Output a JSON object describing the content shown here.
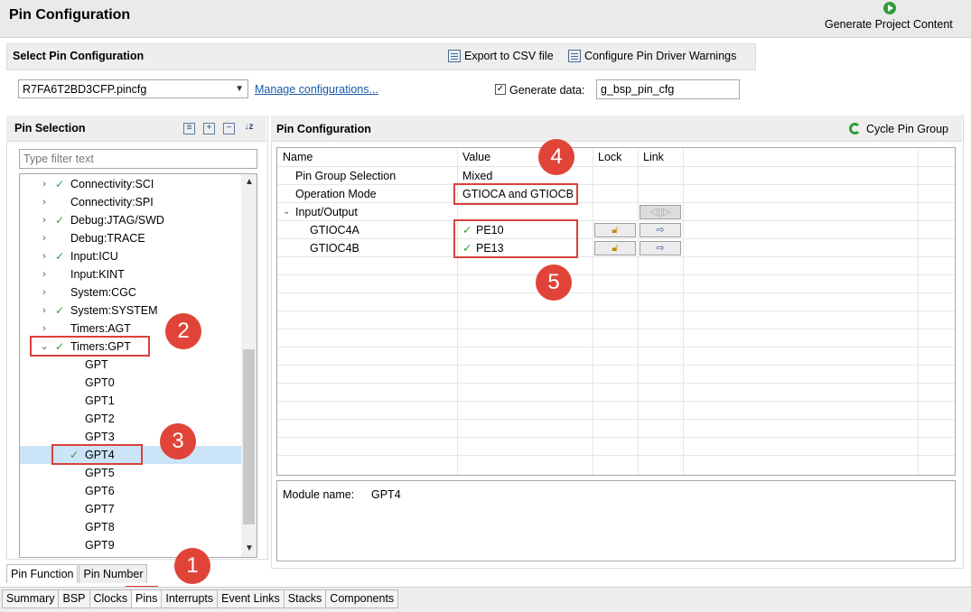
{
  "header": {
    "title": "Pin Configuration",
    "generate_label": "Generate Project Content"
  },
  "select_section": {
    "title": "Select Pin Configuration",
    "export_label": "Export to CSV file",
    "warnings_label": "Configure Pin Driver Warnings",
    "selected_config": "R7FA6T2BD3CFP.pincfg",
    "manage_link": "Manage configurations...",
    "generate_data_label": "Generate data:",
    "generate_data_checked": true,
    "generate_data_value": "g_bsp_pin_cfg"
  },
  "pin_selection": {
    "title": "Pin Selection",
    "filter_placeholder": "Type filter text",
    "items": [
      {
        "label": "Connectivity:SCI",
        "checked": true,
        "expander": "collapsed",
        "level": 0
      },
      {
        "label": "Connectivity:SPI",
        "checked": false,
        "expander": "collapsed",
        "level": 0
      },
      {
        "label": "Debug:JTAG/SWD",
        "checked": true,
        "expander": "collapsed",
        "level": 0
      },
      {
        "label": "Debug:TRACE",
        "checked": false,
        "expander": "collapsed",
        "level": 0
      },
      {
        "label": "Input:ICU",
        "checked": true,
        "expander": "collapsed",
        "level": 0
      },
      {
        "label": "Input:KINT",
        "checked": false,
        "expander": "collapsed",
        "level": 0
      },
      {
        "label": "System:CGC",
        "checked": false,
        "expander": "collapsed",
        "level": 0
      },
      {
        "label": "System:SYSTEM",
        "checked": true,
        "expander": "collapsed",
        "level": 0
      },
      {
        "label": "Timers:AGT",
        "checked": false,
        "expander": "collapsed",
        "level": 0
      },
      {
        "label": "Timers:GPT",
        "checked": true,
        "expander": "expanded",
        "level": 0
      },
      {
        "label": "GPT",
        "checked": false,
        "level": 1
      },
      {
        "label": "GPT0",
        "checked": false,
        "level": 1
      },
      {
        "label": "GPT1",
        "checked": false,
        "level": 1
      },
      {
        "label": "GPT2",
        "checked": false,
        "level": 1
      },
      {
        "label": "GPT3",
        "checked": false,
        "level": 1
      },
      {
        "label": "GPT4",
        "checked": true,
        "level": 1,
        "selected": true
      },
      {
        "label": "GPT5",
        "checked": false,
        "level": 1
      },
      {
        "label": "GPT6",
        "checked": false,
        "level": 1
      },
      {
        "label": "GPT7",
        "checked": false,
        "level": 1
      },
      {
        "label": "GPT8",
        "checked": false,
        "level": 1
      },
      {
        "label": "GPT9",
        "checked": false,
        "level": 1
      }
    ]
  },
  "pin_config": {
    "title": "Pin Configuration",
    "cycle_label": "Cycle Pin Group",
    "columns": {
      "name": "Name",
      "value": "Value",
      "lock": "Lock",
      "link": "Link"
    },
    "rows": {
      "group_name": "Pin Group Selection",
      "group_value": "Mixed",
      "mode_name": "Operation Mode",
      "mode_value": "GTIOCA and GTIOCB",
      "io_name": "Input/Output",
      "gt4a_name": "GTIOC4A",
      "gt4a_value": "PE10",
      "gt4b_name": "GTIOC4B",
      "gt4b_value": "PE13"
    },
    "module_label": "Module name:",
    "module_value": "GPT4"
  },
  "callouts": {
    "c1": "1",
    "c2": "2",
    "c3": "3",
    "c4": "4",
    "c5": "5"
  },
  "view_tabs": {
    "function": "Pin Function",
    "number": "Pin Number"
  },
  "bottom_tabs": [
    "Summary",
    "BSP",
    "Clocks",
    "Pins",
    "Interrupts",
    "Event Links",
    "Stacks",
    "Components"
  ],
  "colors": {
    "accent_check": "#2e9d3b",
    "highlight": "#d9413a",
    "selection": "#cce4f7"
  }
}
